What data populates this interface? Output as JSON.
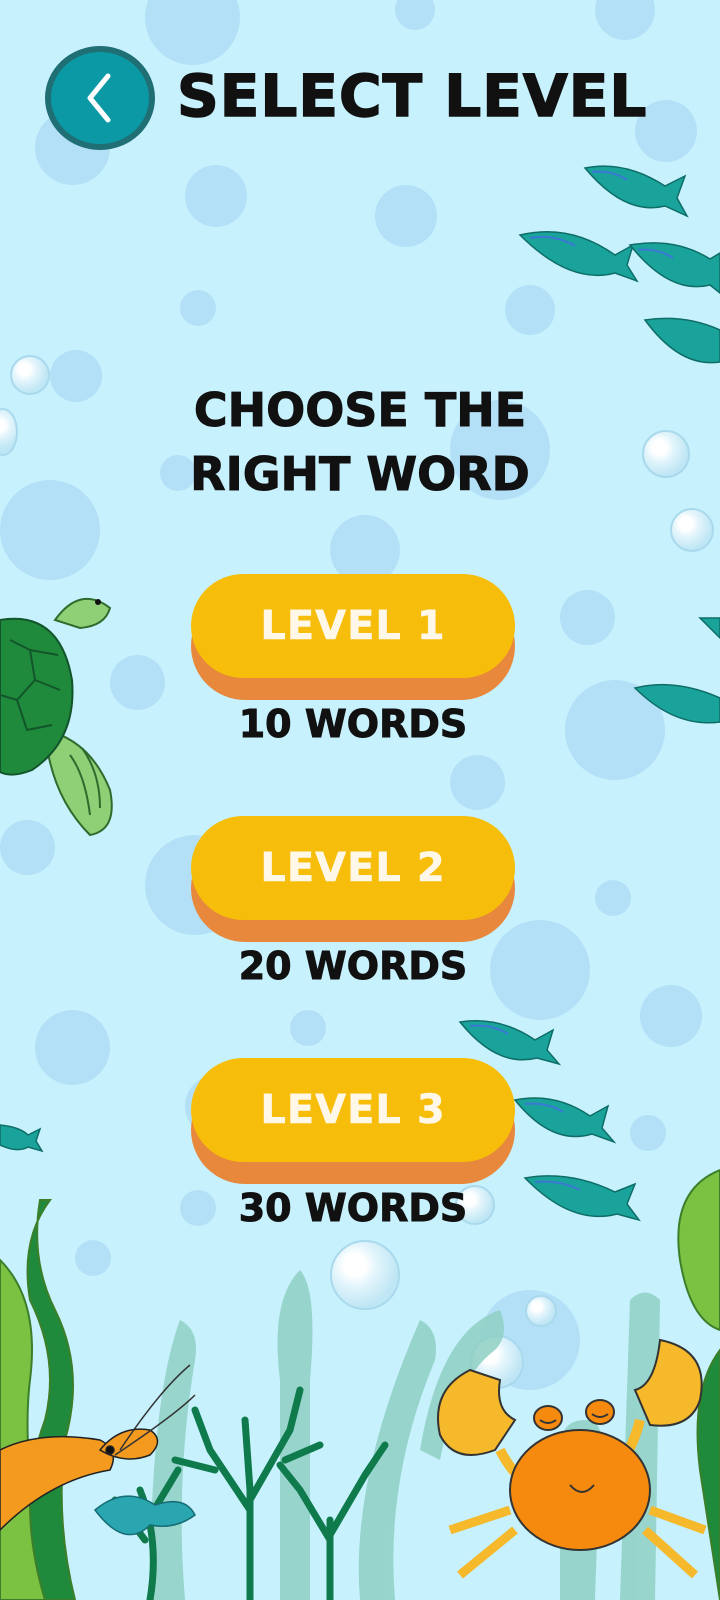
{
  "header": {
    "title": "SELECT LEVEL",
    "back_icon": "chevron-left-icon"
  },
  "game": {
    "name": "CHOOSE THE RIGHT WORD"
  },
  "levels": [
    {
      "label": "LEVEL 1",
      "words": "10 WORDS"
    },
    {
      "label": "LEVEL 2",
      "words": "20 WORDS"
    },
    {
      "label": "LEVEL 3",
      "words": "30 WORDS"
    }
  ],
  "colors": {
    "background": "#c7f1fd",
    "button": "#f6be0a",
    "button_shadow": "#e8883d",
    "back_button": "#0b9aa5"
  }
}
